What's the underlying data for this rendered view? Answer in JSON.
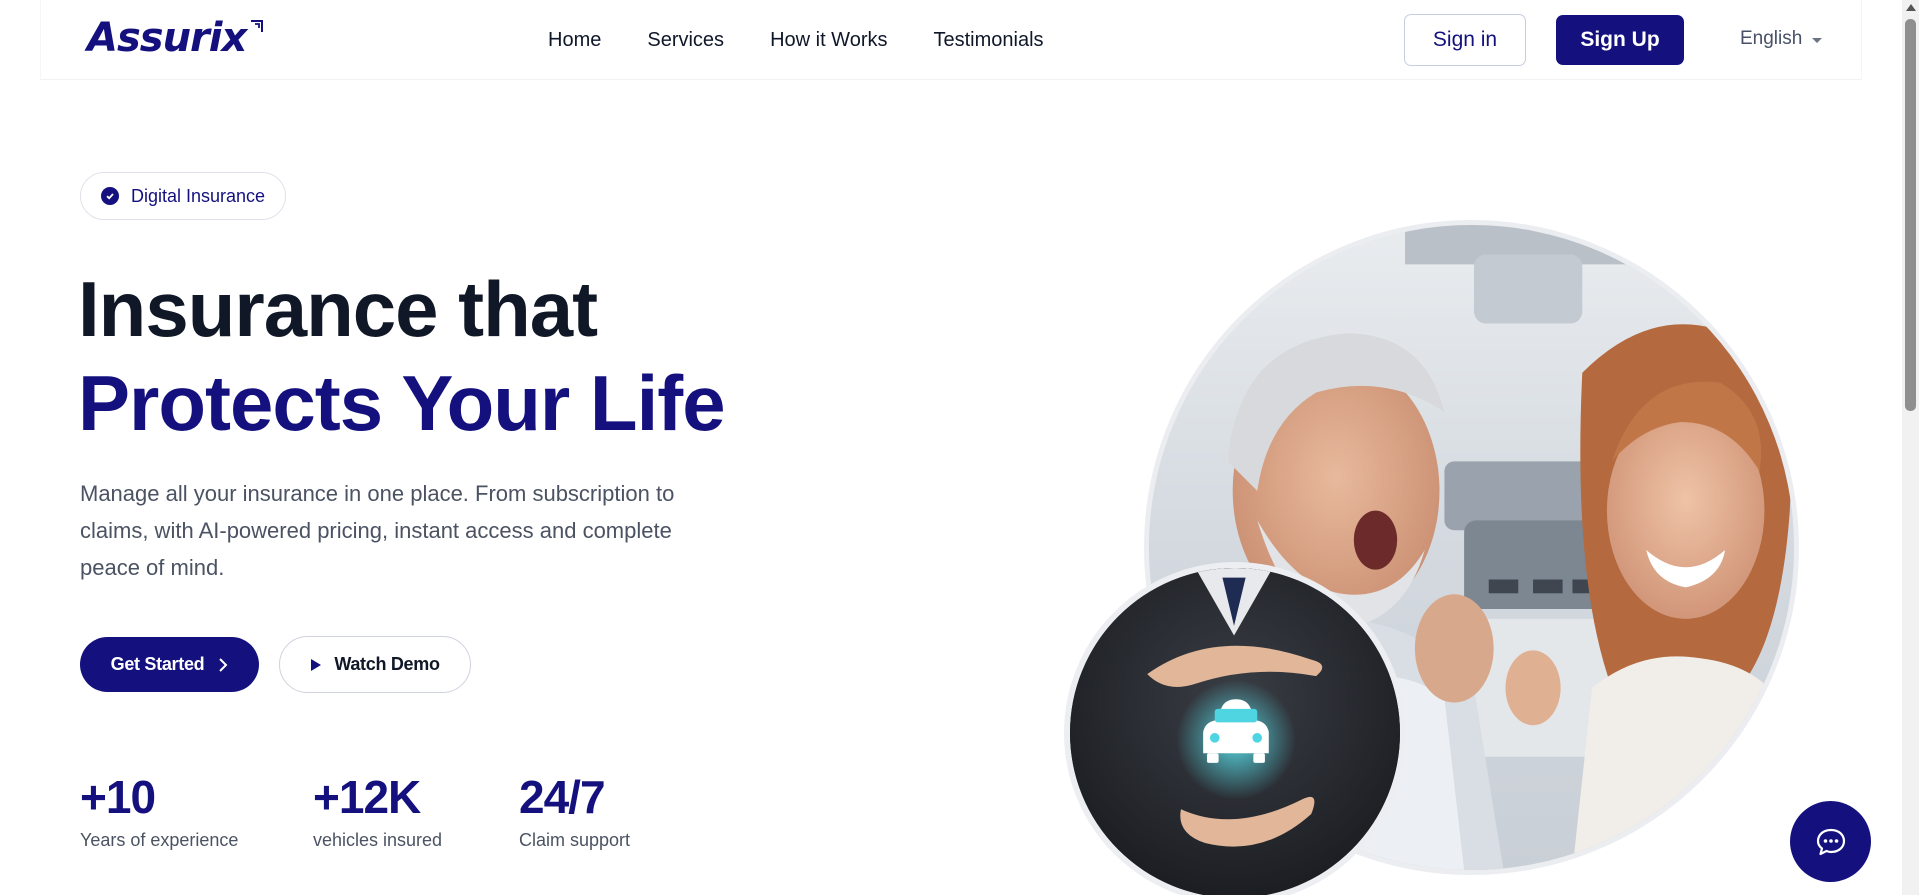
{
  "header": {
    "logo_text": "Assurix",
    "nav": [
      "Home",
      "Services",
      "How it Works",
      "Testimonials"
    ],
    "signin_label": "Sign in",
    "signup_label": "Sign Up",
    "language": "English"
  },
  "hero": {
    "badge": "Digital Insurance",
    "headline_line1": "Insurance that",
    "headline_line2": "Protects Your Life",
    "description": "Manage all your insurance in one place. From subscription to claims, with AI-powered pricing, instant access and complete peace of mind.",
    "cta_primary": "Get Started",
    "cta_secondary": "Watch Demo",
    "stats": [
      {
        "value": "+10",
        "label": "Years of experience"
      },
      {
        "value": "+12K",
        "label": "vehicles insured"
      },
      {
        "value": "24/7",
        "label": "Claim support"
      }
    ]
  },
  "colors": {
    "brand": "#14117f",
    "heading": "#101827",
    "body_text": "#4b5363"
  },
  "icons": [
    "logo-arrow-icon",
    "check-circle-icon",
    "chevron-right-icon",
    "play-icon",
    "chat-icon",
    "caret-down-icon",
    "car-icon"
  ]
}
